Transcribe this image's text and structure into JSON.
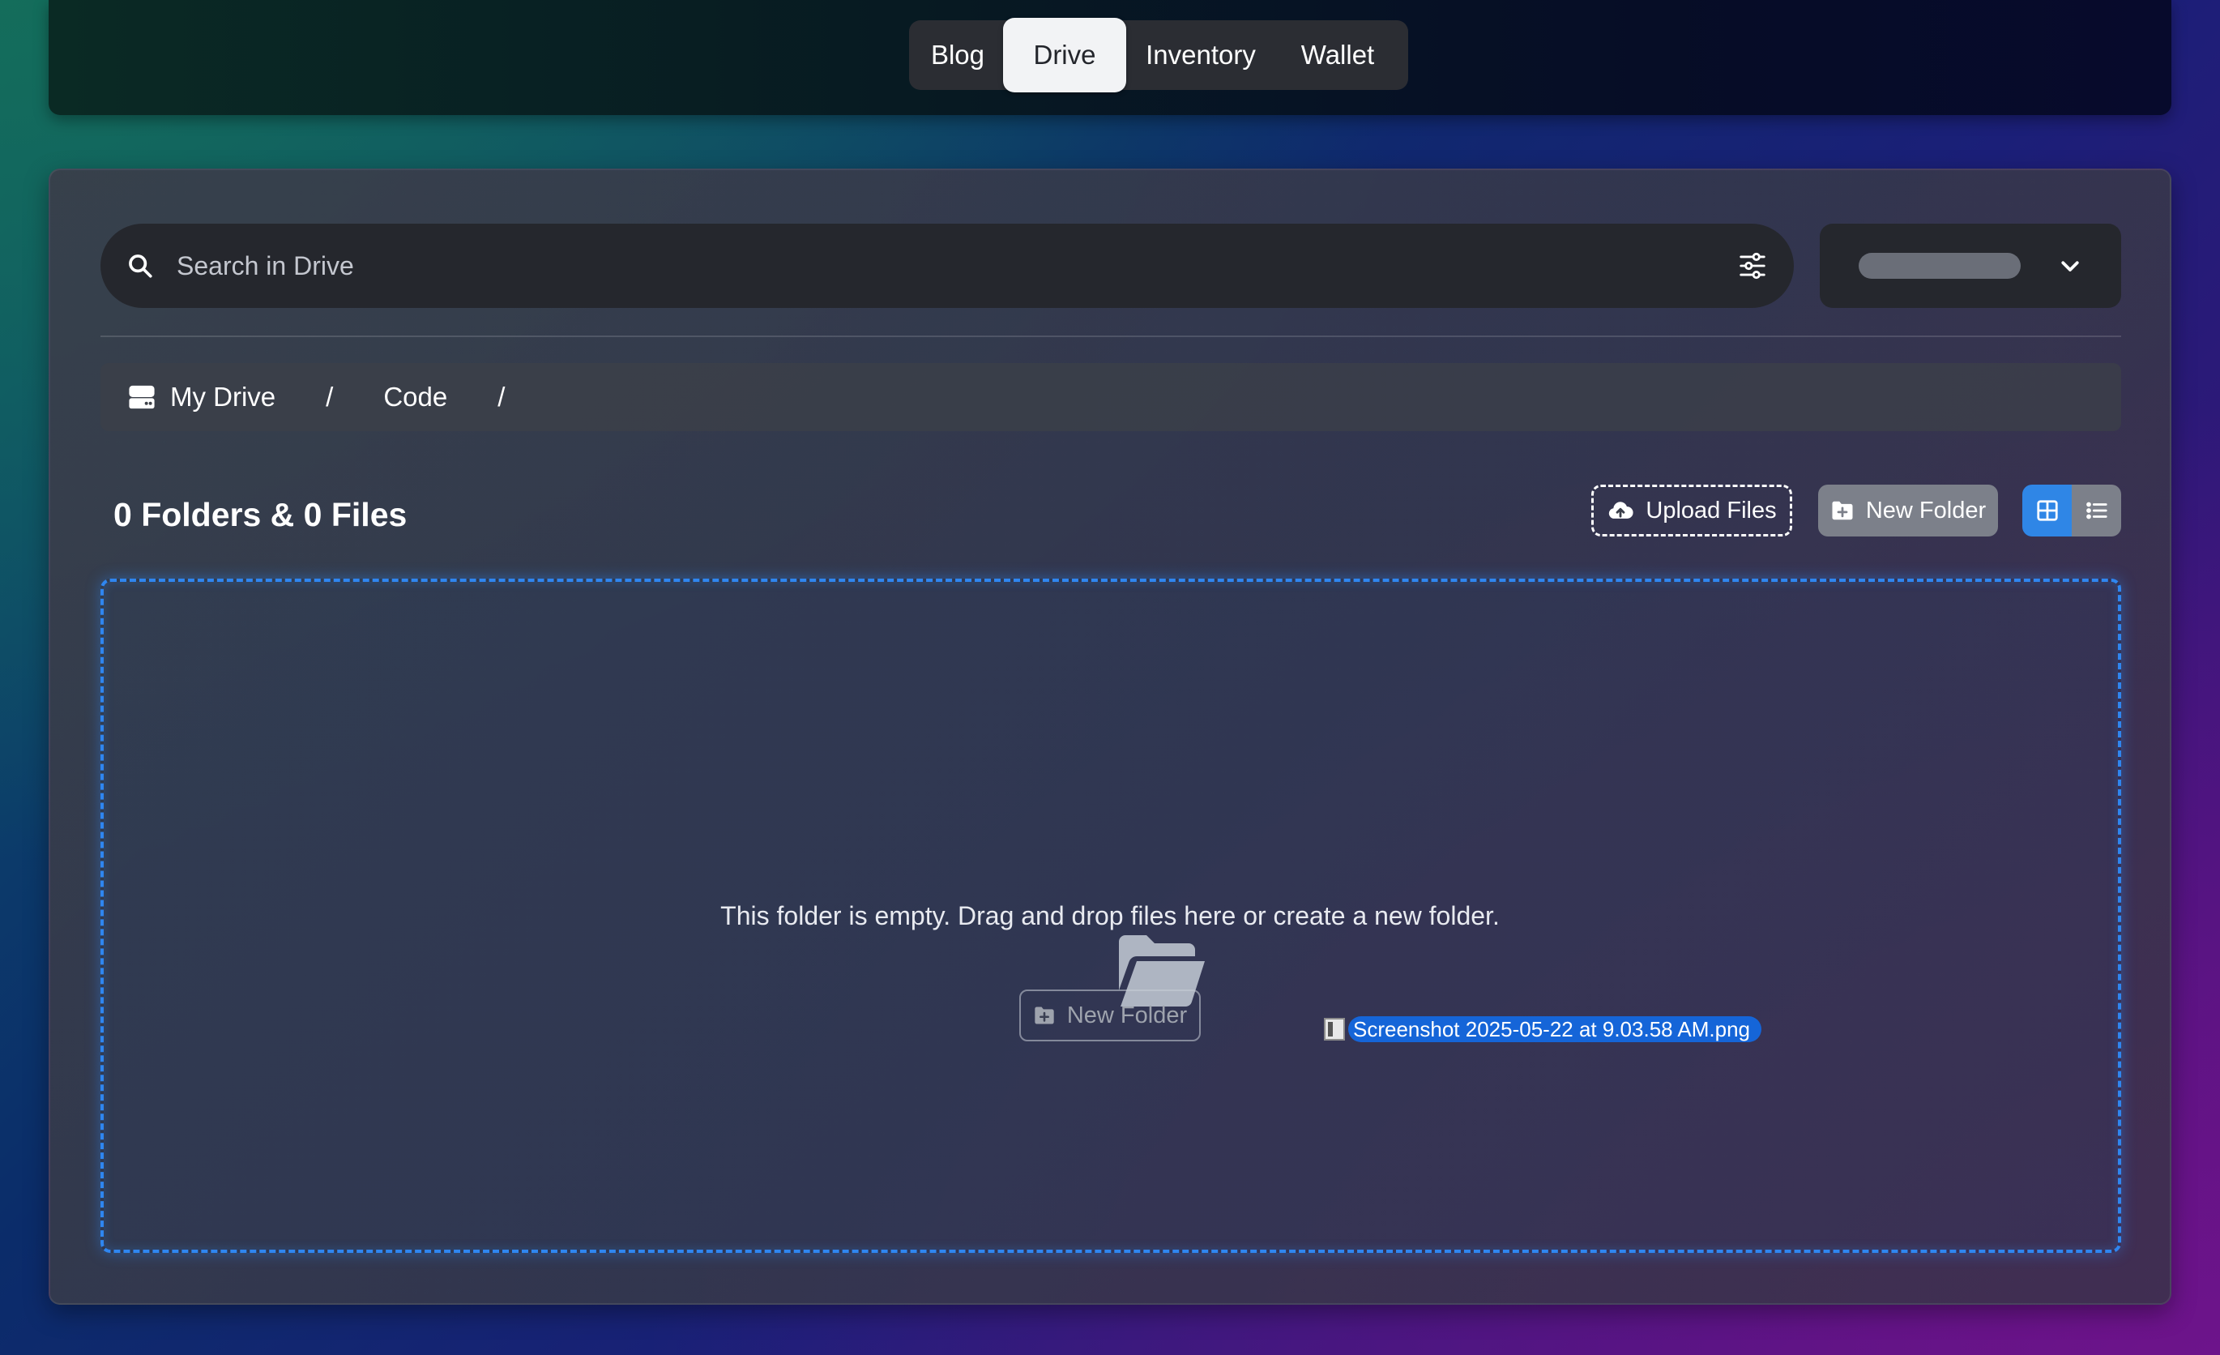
{
  "nav": {
    "tabs": [
      {
        "label": "Blog",
        "active": false
      },
      {
        "label": "Drive",
        "active": true
      },
      {
        "label": "Inventory",
        "active": false
      },
      {
        "label": "Wallet",
        "active": false
      }
    ]
  },
  "search": {
    "placeholder": "Search in Drive",
    "icon": "search-icon",
    "filter_icon": "sliders-icon"
  },
  "drive_selector": {
    "state": "loading",
    "icon": "chevron-down-icon"
  },
  "breadcrumb": {
    "icon": "hard-drive-icon",
    "items": [
      "My Drive",
      "Code"
    ],
    "separator": "/"
  },
  "toolbar": {
    "counts_label": "0 Folders & 0 Files",
    "upload_label": "Upload Files",
    "new_folder_label": "New Folder",
    "view_mode": "grid"
  },
  "dropzone": {
    "empty_icon": "folder-open-icon",
    "empty_message": "This folder is empty. Drag and drop files here or create a new folder.",
    "new_folder_label": "New Folder",
    "dragged_file": "Screenshot 2025-05-22 at 9.03.58 AM.png"
  },
  "colors": {
    "accent": "#2f86e6",
    "dropzone_border": "#2f86f0",
    "drag_highlight": "#1565d8"
  }
}
